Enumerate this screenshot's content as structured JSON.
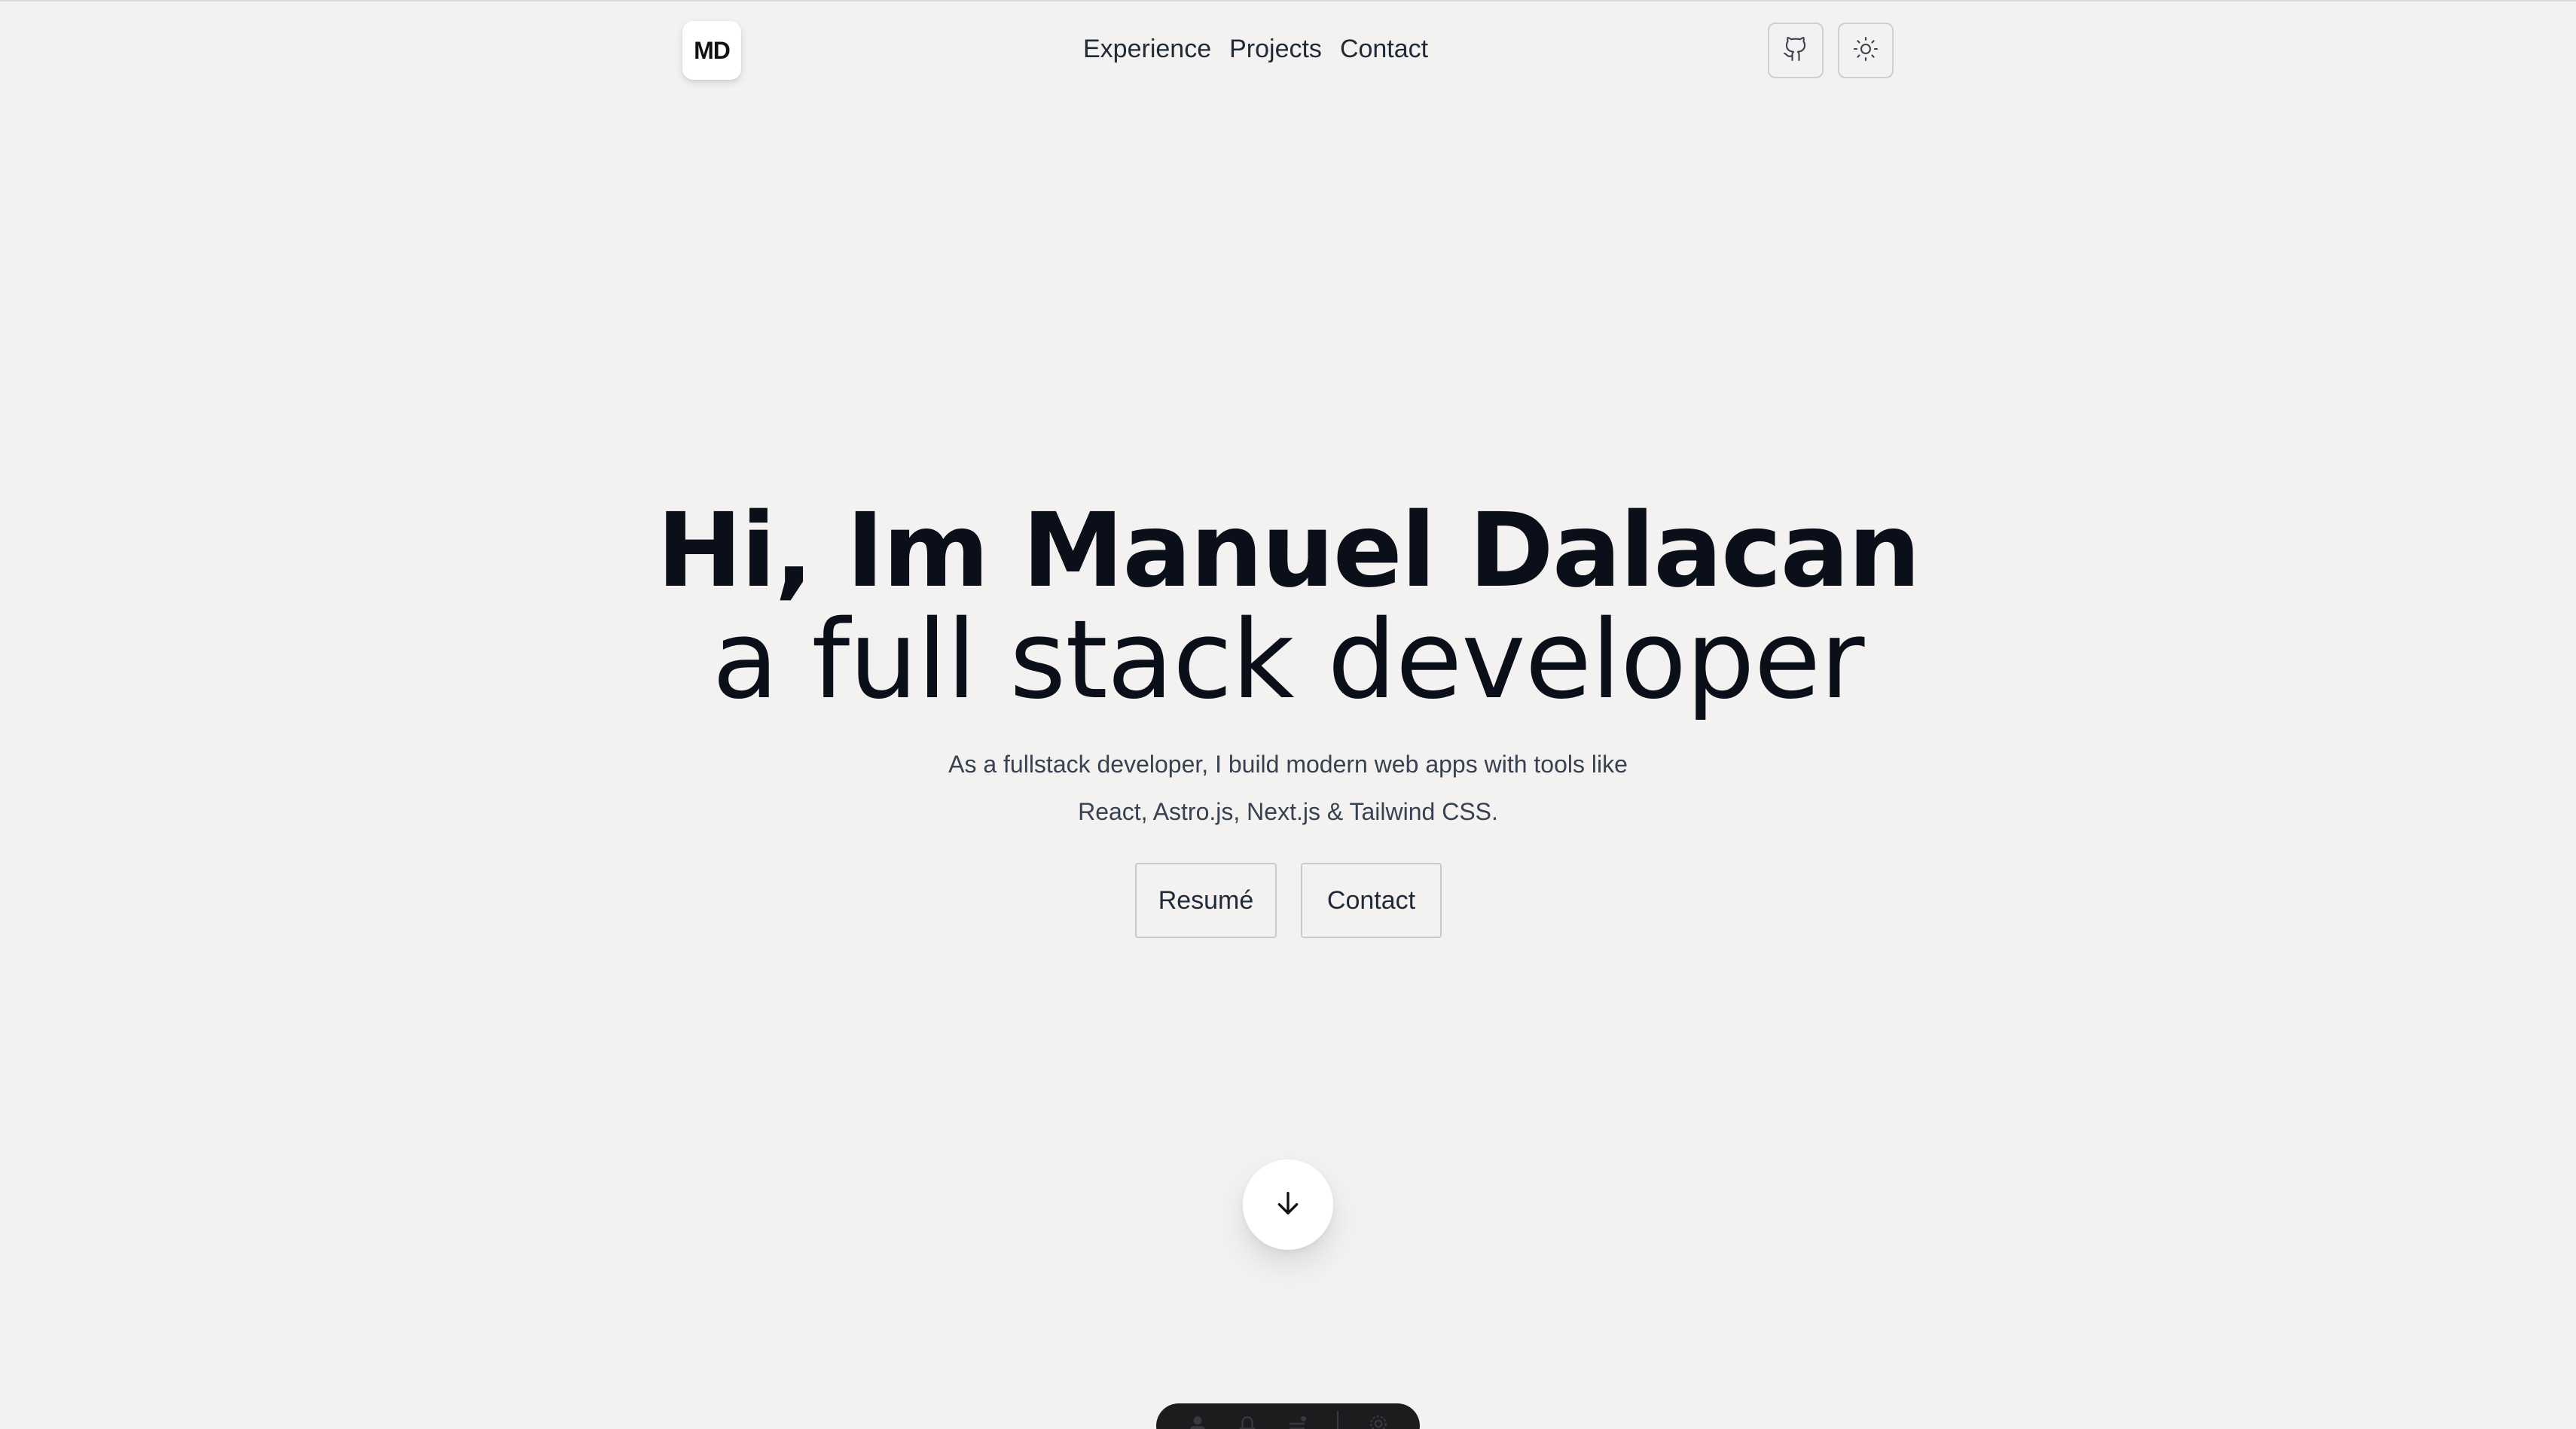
{
  "header": {
    "logo_text": "MD",
    "nav": [
      {
        "label": "Experience"
      },
      {
        "label": "Projects"
      },
      {
        "label": "Contact"
      }
    ],
    "icons": [
      "github-icon",
      "sun-icon"
    ]
  },
  "hero": {
    "title_line1": "Hi, Im Manuel Dalacan",
    "title_line2": "a full stack developer",
    "subtitle_line1": "As a fullstack developer, I build modern web apps with tools like",
    "subtitle_line2": "React, Astro.js, Next.js & Tailwind CSS.",
    "buttons": [
      {
        "label": "Resumé"
      },
      {
        "label": "Contact"
      }
    ],
    "scroll_icon": "arrow-down-icon"
  },
  "dock": {
    "icons": [
      "user-icon",
      "bell-icon",
      "menu-icon",
      "gear-icon"
    ]
  },
  "colors": {
    "background": "#f3f2f0",
    "text": "#0b0f19",
    "dock": "#1c1c1e"
  }
}
